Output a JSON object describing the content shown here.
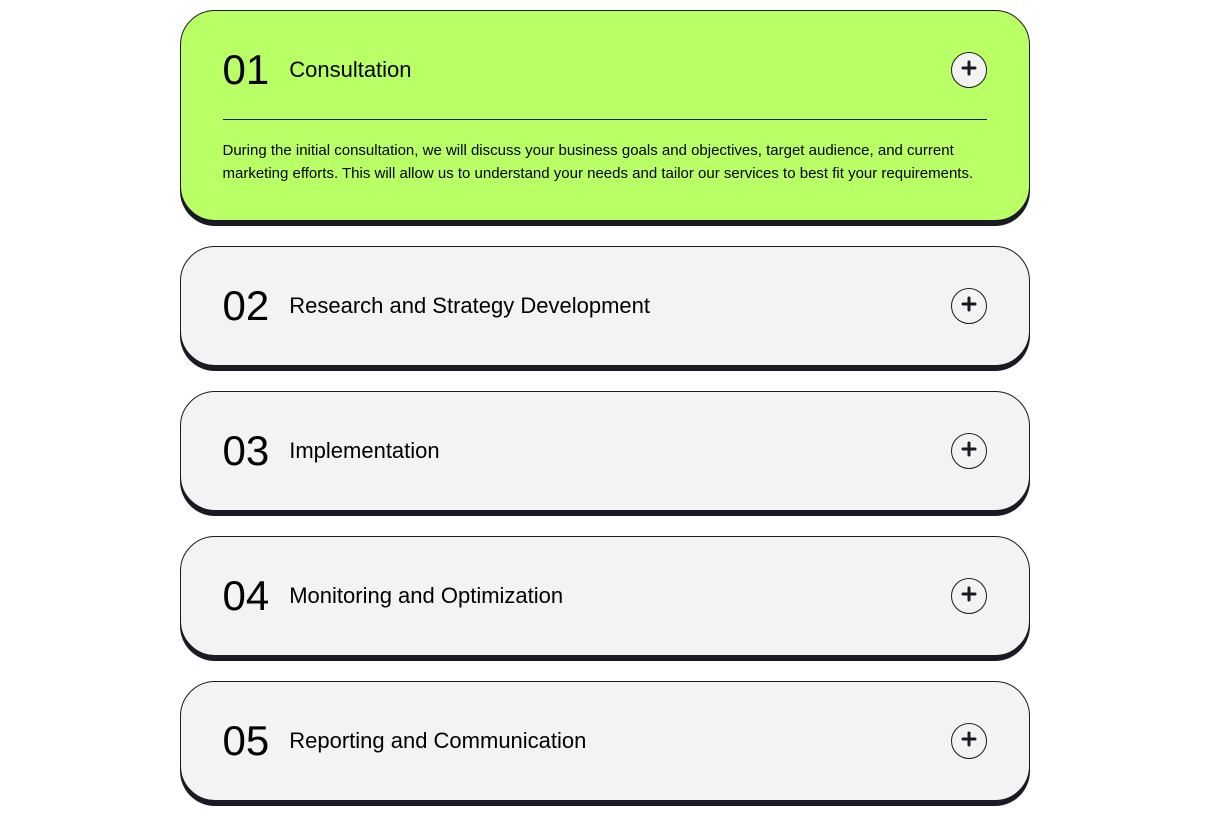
{
  "accordion": {
    "items": [
      {
        "number": "01",
        "title": "Consultation",
        "body": "During the initial consultation, we will discuss your business goals and objectives, target audience, and current marketing efforts. This will allow us to understand your needs and tailor our services to best fit your requirements.",
        "expanded": true
      },
      {
        "number": "02",
        "title": "Research and Strategy Development",
        "body": "",
        "expanded": false
      },
      {
        "number": "03",
        "title": "Implementation",
        "body": "",
        "expanded": false
      },
      {
        "number": "04",
        "title": "Monitoring and Optimization",
        "body": "",
        "expanded": false
      },
      {
        "number": "05",
        "title": "Reporting and Communication",
        "body": "",
        "expanded": false
      }
    ]
  }
}
